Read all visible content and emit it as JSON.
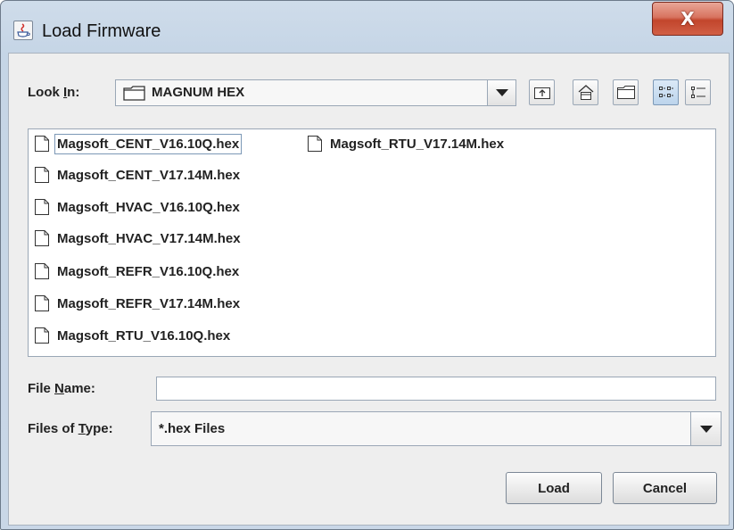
{
  "window": {
    "title": "Load Firmware",
    "close_label": "X"
  },
  "look_in": {
    "label_pre": "Look ",
    "label_mnemonic": "I",
    "label_post": "n:",
    "value": "MAGNUM HEX"
  },
  "files": [
    {
      "name": "Magsoft_CENT_V16.10Q.hex",
      "selected": true
    },
    {
      "name": "Magsoft_CENT_V17.14M.hex",
      "selected": false
    },
    {
      "name": "Magsoft_HVAC_V16.10Q.hex",
      "selected": false
    },
    {
      "name": "Magsoft_HVAC_V17.14M.hex",
      "selected": false
    },
    {
      "name": "Magsoft_REFR_V16.10Q.hex",
      "selected": false
    },
    {
      "name": "Magsoft_REFR_V17.14M.hex",
      "selected": false
    },
    {
      "name": "Magsoft_RTU_V16.10Q.hex",
      "selected": false
    },
    {
      "name": "Magsoft_RTU_V17.14M.hex",
      "selected": false
    }
  ],
  "file_name": {
    "label_pre": "File ",
    "label_mnemonic": "N",
    "label_post": "ame:",
    "value": ""
  },
  "file_type": {
    "label_pre": "Files of ",
    "label_mnemonic": "T",
    "label_post": "ype:",
    "value": "*.hex Files"
  },
  "buttons": {
    "load": "Load",
    "cancel": "Cancel"
  },
  "icons": [
    "up-folder-icon",
    "home-icon",
    "new-folder-icon",
    "list-view-icon",
    "details-view-icon",
    "file-icon",
    "folder-icon",
    "dropdown-arrow-icon",
    "java-app-icon"
  ],
  "colors": {
    "title_bar": "#c5d5e6",
    "close_button": "#c94a31",
    "content_bg": "#eeeeee",
    "active_toggle": "#bcd4ec"
  }
}
